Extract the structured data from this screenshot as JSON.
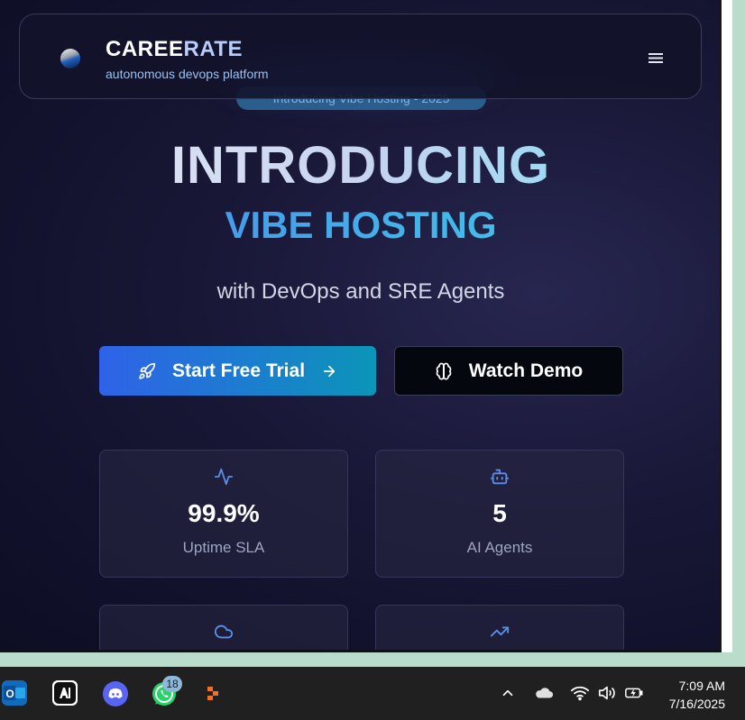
{
  "nav": {
    "brand_part1": "CAREE",
    "brand_part2": "RATE",
    "tagline": "autonomous devops platform",
    "menu_icon": "hamburger-menu-icon"
  },
  "hero": {
    "badge": "Introducing Vibe Hosting - 2025",
    "title": "INTRODUCING",
    "subtitle": "VIBE HOSTING",
    "tagline": "with DevOps and SRE Agents"
  },
  "actions": {
    "primary_label": "Start Free Trial",
    "secondary_label": "Watch Demo"
  },
  "stats": [
    {
      "icon": "activity-icon",
      "value": "99.9%",
      "label": "Uptime SLA"
    },
    {
      "icon": "bot-icon",
      "value": "5",
      "label": "AI Agents"
    },
    {
      "icon": "cloud-icon",
      "value": "",
      "label": ""
    },
    {
      "icon": "trending-up-icon",
      "value": "",
      "label": ""
    }
  ],
  "taskbar": {
    "whatsapp_badge": "18",
    "time": "7:09 AM",
    "date": "7/16/2025"
  },
  "colors": {
    "accent_blue": "#2f62e8",
    "accent_cyan": "#0b95b8",
    "icon_blue": "#5a8fe8"
  }
}
